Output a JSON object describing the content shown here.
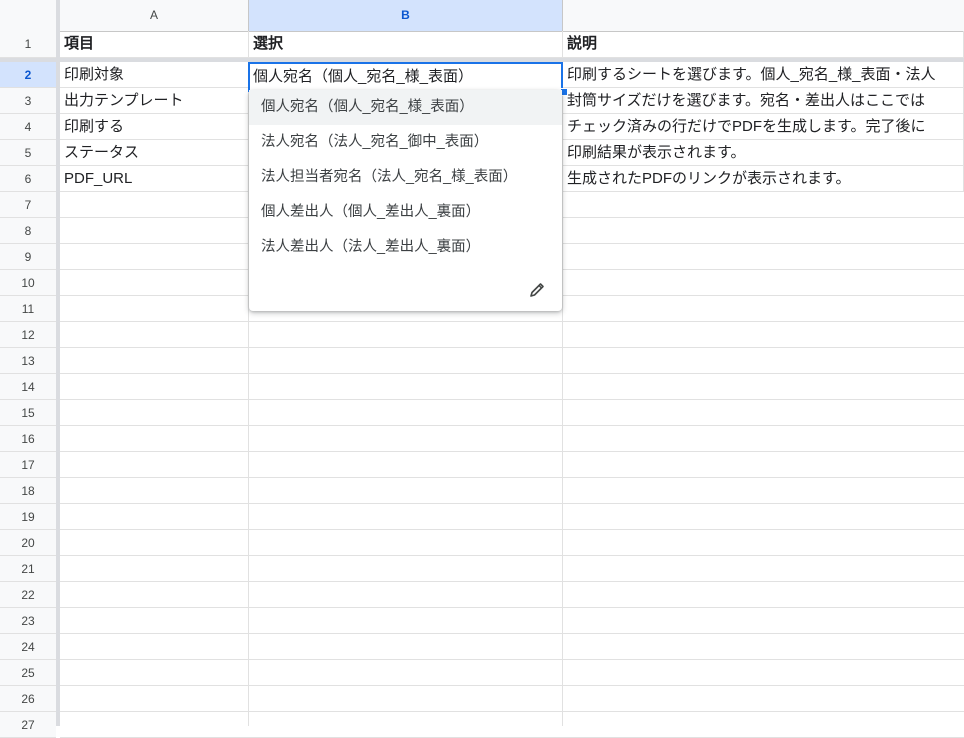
{
  "columns": [
    {
      "letter": "A",
      "selected": false
    },
    {
      "letter": "B",
      "selected": true
    }
  ],
  "rows": [
    "1",
    "2",
    "3",
    "4",
    "5",
    "6",
    "7",
    "8",
    "9",
    "10",
    "11",
    "12",
    "13",
    "14",
    "15",
    "16",
    "17",
    "18",
    "19",
    "20",
    "21",
    "22",
    "23",
    "24",
    "25",
    "26",
    "27"
  ],
  "selected_row": "2",
  "header_row": {
    "a": "項目",
    "b": "選択",
    "c": "説明"
  },
  "data_rows": [
    {
      "a": "印刷対象",
      "b": "個人宛名（個人_宛名_様_表面）",
      "c": "印刷するシートを選びます。個人_宛名_様_表面・法人"
    },
    {
      "a": "出力テンプレート",
      "b": "",
      "c": "封筒サイズだけを選びます。宛名・差出人はここでは"
    },
    {
      "a": "印刷する",
      "b": "",
      "c": "チェック済みの行だけでPDFを生成します。完了後に"
    },
    {
      "a": "ステータス",
      "b": "",
      "c": "印刷結果が表示されます。"
    },
    {
      "a": "PDF_URL",
      "b": "",
      "c": "生成されたPDFのリンクが表示されます。"
    }
  ],
  "dropdown": {
    "options": [
      "個人宛名（個人_宛名_様_表面）",
      "法人宛名（法人_宛名_御中_表面）",
      "法人担当者宛名（法人_宛名_様_表面）",
      "個人差出人（個人_差出人_裏面）",
      "法人差出人（法人_差出人_裏面）"
    ],
    "highlighted_index": 0,
    "edit_icon": "pencil-icon"
  },
  "colors": {
    "selection_blue": "#1a73e8",
    "header_selected_bg": "#d3e3fd",
    "header_selected_text": "#0b57d0"
  }
}
